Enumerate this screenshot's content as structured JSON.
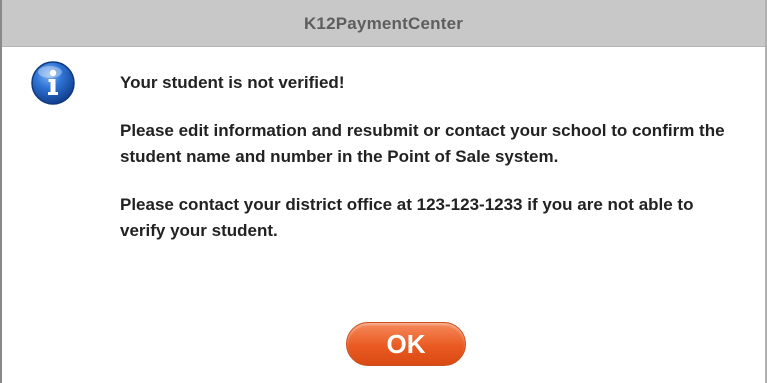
{
  "window": {
    "title": "K12PaymentCenter"
  },
  "dialog": {
    "icon": "info-icon",
    "headline": "Your student is not verified!",
    "paragraph1": "Please edit information and resubmit or contact your school to confirm the student name and number in the Point of Sale system.",
    "paragraph2": "Please contact your district office at 123-123-1233 if you are not able to verify your student.",
    "ok_label": "OK"
  },
  "colors": {
    "titlebar": "#c8c8c8",
    "title_text": "#5e5e5e",
    "button_accent": "#ea5a22",
    "icon_blue": "#1a5fc2"
  }
}
